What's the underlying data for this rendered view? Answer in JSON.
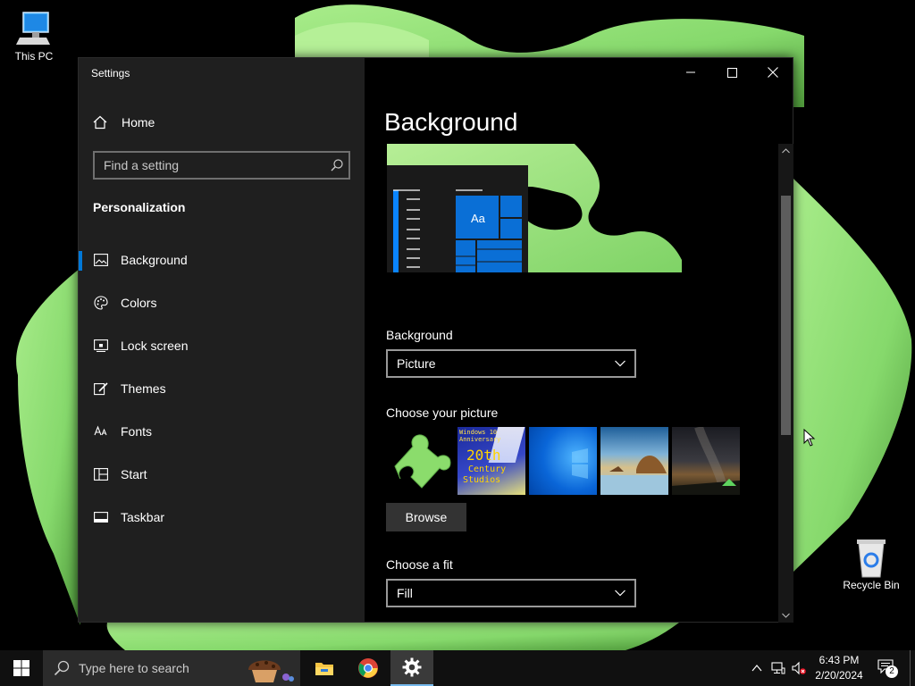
{
  "desktop": {
    "icons": [
      {
        "label": "This PC"
      },
      {
        "label": "Recycle Bin"
      }
    ]
  },
  "window": {
    "title": "Settings",
    "controls": {
      "minimize": "minimize-icon",
      "maximize": "maximize-icon",
      "close": "close-icon"
    }
  },
  "sidebar": {
    "home_label": "Home",
    "search_placeholder": "Find a setting",
    "section_title": "Personalization",
    "items": [
      {
        "label": "Background",
        "icon": "picture-icon",
        "selected": true
      },
      {
        "label": "Colors",
        "icon": "palette-icon"
      },
      {
        "label": "Lock screen",
        "icon": "lock-screen-icon"
      },
      {
        "label": "Themes",
        "icon": "brush-icon"
      },
      {
        "label": "Fonts",
        "icon": "fonts-icon"
      },
      {
        "label": "Start",
        "icon": "start-icon"
      },
      {
        "label": "Taskbar",
        "icon": "taskbar-icon"
      }
    ]
  },
  "content": {
    "title": "Background",
    "preview": {
      "tile_text": "Aa"
    },
    "background_label": "Background",
    "background_value": "Picture",
    "choose_picture_label": "Choose your picture",
    "pictures": [
      {
        "name": "puzzle-piece-thumb"
      },
      {
        "name": "windows-anniversary-thumb",
        "text": "Windows 10 Anniversary",
        "line1": "20th",
        "line2": "Century",
        "line3": "Studios"
      },
      {
        "name": "windows-logo-thumb"
      },
      {
        "name": "beach-rocks-thumb"
      },
      {
        "name": "night-sky-tent-thumb"
      }
    ],
    "browse_label": "Browse",
    "choose_fit_label": "Choose a fit",
    "fit_value": "Fill"
  },
  "taskbar": {
    "search_placeholder": "Type here to search",
    "apps": [
      "file-explorer-icon",
      "chrome-icon",
      "settings-icon"
    ],
    "time": "6:43 PM",
    "date": "2/20/2024",
    "notification_count": "2"
  },
  "colors": {
    "accent": "#0078d7",
    "wallpaper_green": "#8fe07a",
    "sidebar_bg": "#1f1f1f"
  }
}
